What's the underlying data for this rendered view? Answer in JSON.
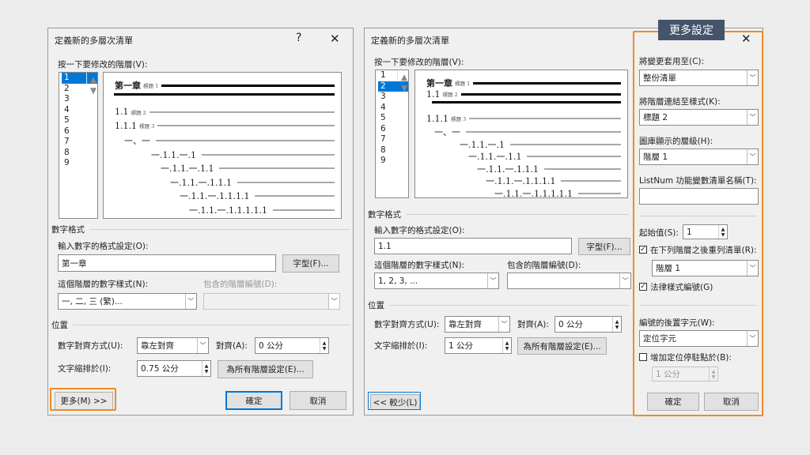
{
  "left": {
    "title": "定義新的多層次清單",
    "help": "?",
    "close": "✕",
    "click_level_label": "按一下要修改的階層(V):",
    "levels": [
      "1",
      "2",
      "3",
      "4",
      "5",
      "6",
      "7",
      "8",
      "9"
    ],
    "preview": [
      {
        "text": "第一章",
        "style": "標題 1"
      },
      {
        "text": "",
        "style": ""
      },
      {
        "text": "1.1",
        "style": "標題 2"
      },
      {
        "text": "1.1.1",
        "style": "標題 3"
      },
      {
        "text": "一、一",
        "style": ""
      },
      {
        "text": "一.1.1.一.1",
        "style": ""
      },
      {
        "text": "一.1.1.一.1.1",
        "style": ""
      },
      {
        "text": "一.1.1.一.1.1.1",
        "style": ""
      },
      {
        "text": "一.1.1.一.1.1.1.1",
        "style": ""
      },
      {
        "text": "一.1.1.一.1.1.1.1.1",
        "style": ""
      }
    ],
    "number_format_section": "數字格式",
    "enter_format_label": "輸入數字的格式設定(O):",
    "format_value": "第一章",
    "font_button": "字型(F)...",
    "number_style_label": "這個階層的數字樣式(N):",
    "number_style_value": "一, 二, 三 (繁)...",
    "include_level_label": "包含的階層編號(D):",
    "position_section": "位置",
    "alignment_label": "數字對齊方式(U):",
    "alignment_value": "靠左對齊",
    "aligned_at_label": "對齊(A):",
    "aligned_at_value": "0 公分",
    "indent_label": "文字縮排於(I):",
    "indent_value": "0.75 公分",
    "set_all_button": "為所有階層設定(E)...",
    "more_button": "更多(M) >>",
    "ok_button": "確定",
    "cancel_button": "取消"
  },
  "right": {
    "title": "定義新的多層次清單",
    "close": "✕",
    "click_level_label": "按一下要修改的階層(V):",
    "levels": [
      "1",
      "2",
      "3",
      "4",
      "5",
      "6",
      "7",
      "8",
      "9"
    ],
    "preview": [
      {
        "text": "第一章",
        "style": "標題 1"
      },
      {
        "text": "1.1",
        "style": "標題 2"
      },
      {
        "text": "",
        "style": ""
      },
      {
        "text": "1.1.1",
        "style": "標題 3"
      },
      {
        "text": "一、一",
        "style": ""
      },
      {
        "text": "一.1.1.一.1",
        "style": ""
      },
      {
        "text": "一.1.1.一.1.1",
        "style": ""
      },
      {
        "text": "一.1.1.一.1.1.1",
        "style": ""
      },
      {
        "text": "一.1.1.一.1.1.1.1",
        "style": ""
      },
      {
        "text": "一.1.1.一.1.1.1.1.1",
        "style": ""
      }
    ],
    "number_format_section": "數字格式",
    "enter_format_label": "輸入數字的格式設定(O):",
    "format_value": "1.1",
    "font_button": "字型(F)...",
    "number_style_label": "這個階層的數字樣式(N):",
    "number_style_value": "1, 2, 3, ...",
    "include_level_label": "包含的階層編號(D):",
    "position_section": "位置",
    "alignment_label": "數字對齊方式(U):",
    "alignment_value": "靠左對齊",
    "aligned_at_label": "對齊(A):",
    "aligned_at_value": "0 公分",
    "indent_label": "文字縮排於(I):",
    "indent_value": "1 公分",
    "set_all_button": "為所有階層設定(E)...",
    "less_button": "<< 較少(L)",
    "more_panel": {
      "callout": "更多設定",
      "apply_to_label": "將變更套用至(C):",
      "apply_to_value": "整份清單",
      "link_style_label": "將階層連結至樣式(K):",
      "link_style_value": "標題 2",
      "gallery_level_label": "圖庫顯示的層級(H):",
      "gallery_level_value": "階層 1",
      "listnum_label": "ListNum 功能變數清單名稱(T):",
      "listnum_value": "",
      "start_at_label": "起始值(S):",
      "start_at_value": "1",
      "restart_label": "在下列階層之後重列清單(R):",
      "restart_checked": true,
      "restart_value": "階層 1",
      "legal_label": "法律樣式編號(G)",
      "legal_checked": true,
      "follow_label": "編號的後置字元(W):",
      "follow_value": "定位字元",
      "tab_stop_label": "增加定位停駐點於(B):",
      "tab_stop_checked": false,
      "tab_stop_value": "1 公分",
      "ok_button": "確定",
      "cancel_button": "取消"
    }
  },
  "colors": {
    "accent": "#0078d7",
    "highlight": "#f08a24",
    "callout_bg": "#44546a"
  }
}
